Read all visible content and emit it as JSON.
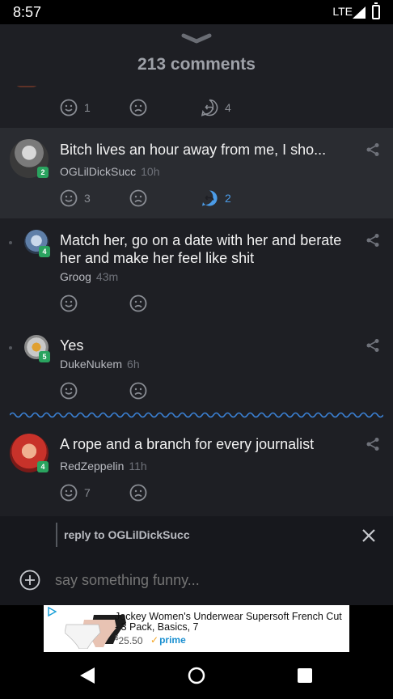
{
  "status": {
    "time": "8:57",
    "network": "LTE"
  },
  "header": {
    "title": "213 comments"
  },
  "prev_comment": {
    "likes": "1",
    "replies": "4"
  },
  "comments": [
    {
      "text": "Bitch lives an hour away from me, I sho...",
      "author": "OGLilDickSucc",
      "ago": "10h",
      "level": "2",
      "likes": "3",
      "replies": "2"
    },
    {
      "text": "Match her, go on a date with her and berate her and make her feel like shit",
      "author": "Groog",
      "ago": "43m",
      "level": "4"
    },
    {
      "text": "Yes",
      "author": "DukeNukem",
      "ago": "6h",
      "level": "5"
    },
    {
      "text": "A rope and a branch for every journalist",
      "author": "RedZeppelin",
      "ago": "11h",
      "level": "4",
      "likes": "7"
    }
  ],
  "reply": {
    "label": "reply to OGLilDickSucc",
    "placeholder": "say something funny..."
  },
  "ad": {
    "title": "Jockey Women's Underwear Supersoft French Cut - 3 Pack, Basics, 7",
    "price_dollars": "25",
    "price_cents": ".50",
    "prime": "prime"
  },
  "colors": {
    "background": "#1e1f24",
    "highlight": "#2a2c31",
    "accent_blue": "#4b9ce8",
    "badge_green": "#2aa35f",
    "wavy_divider": "#3b82d6"
  },
  "icons": [
    "smile-icon",
    "frown-icon",
    "reply-icon",
    "share-icon",
    "chevron-down-icon",
    "close-icon",
    "add-circle-icon",
    "back-icon",
    "home-icon",
    "recents-icon"
  ]
}
